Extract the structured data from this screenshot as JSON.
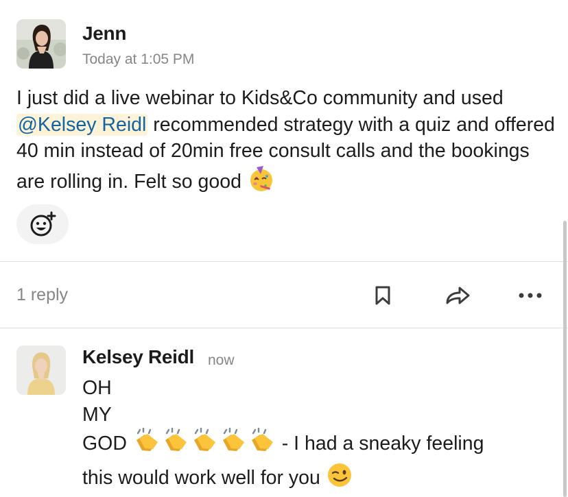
{
  "message": {
    "author": "Jenn",
    "timestamp": "Today at 1:05 PM",
    "text_before_mention": "I just did a live webinar to Kids&Co community and used ",
    "mention": "@Kelsey Reidl",
    "text_after_mention": " recommended strategy with a quiz and offered 40 min instead of 20min free consult calls and the bookings are rolling in. Felt so good",
    "emoji": "partying-face-emoji"
  },
  "thread": {
    "reply_count": "1 reply",
    "actions": [
      "bookmark-icon",
      "share-icon",
      "more-icon"
    ]
  },
  "reply": {
    "author": "Kelsey Reidl",
    "timestamp": "now",
    "line1": "OH",
    "line2": "MY",
    "line3_start": "GOD",
    "line3_end": " - I had a sneaky feeling",
    "line4": "this would work well for you",
    "emojis": [
      "clap-emoji",
      "clap-emoji",
      "clap-emoji",
      "clap-emoji",
      "clap-emoji",
      "wink-emoji"
    ]
  },
  "colors": {
    "mention_text": "#1264a3",
    "mention_bg": "#fdf3d9",
    "muted_text": "#868686"
  }
}
